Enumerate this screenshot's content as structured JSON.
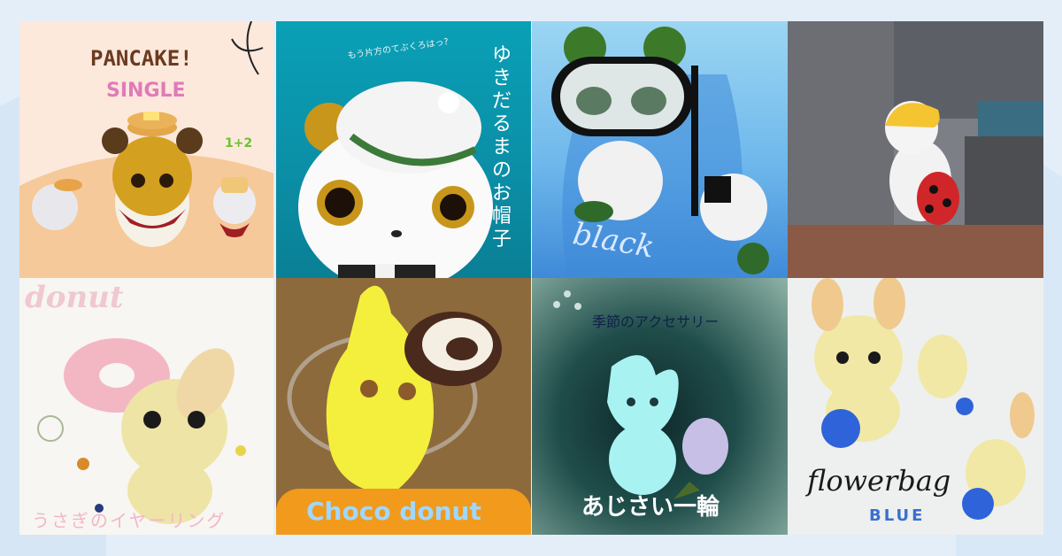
{
  "tiles": [
    {
      "id": "pancake",
      "title": "PANCAKE!",
      "subtitle": "SINGLE",
      "badge": "1+2"
    },
    {
      "id": "snowman-hat",
      "title": "ゆきだるまのお帽子",
      "subtitle": "もう片方のてぶくろはっ?"
    },
    {
      "id": "snorkel",
      "caption": "black"
    },
    {
      "id": "ladybug-bag"
    },
    {
      "id": "donut-earring",
      "title": "donut",
      "caption": "うさぎのイヤーリング"
    },
    {
      "id": "choco-donut",
      "caption": "Choco donut"
    },
    {
      "id": "hydrangea",
      "title": "季節のアクセサリー",
      "caption": "あじさい一輪"
    },
    {
      "id": "flowerbag",
      "title": "flowerbag",
      "caption": "BLUE"
    }
  ],
  "colors": {
    "page_bg": "#e4eef8",
    "pancake_title": "#6b3a1f",
    "single_pink": "#e07ab8",
    "choco_bar": "#f29a1c",
    "choco_text": "#9fd8ff",
    "blue_text": "#3a6fcf"
  }
}
